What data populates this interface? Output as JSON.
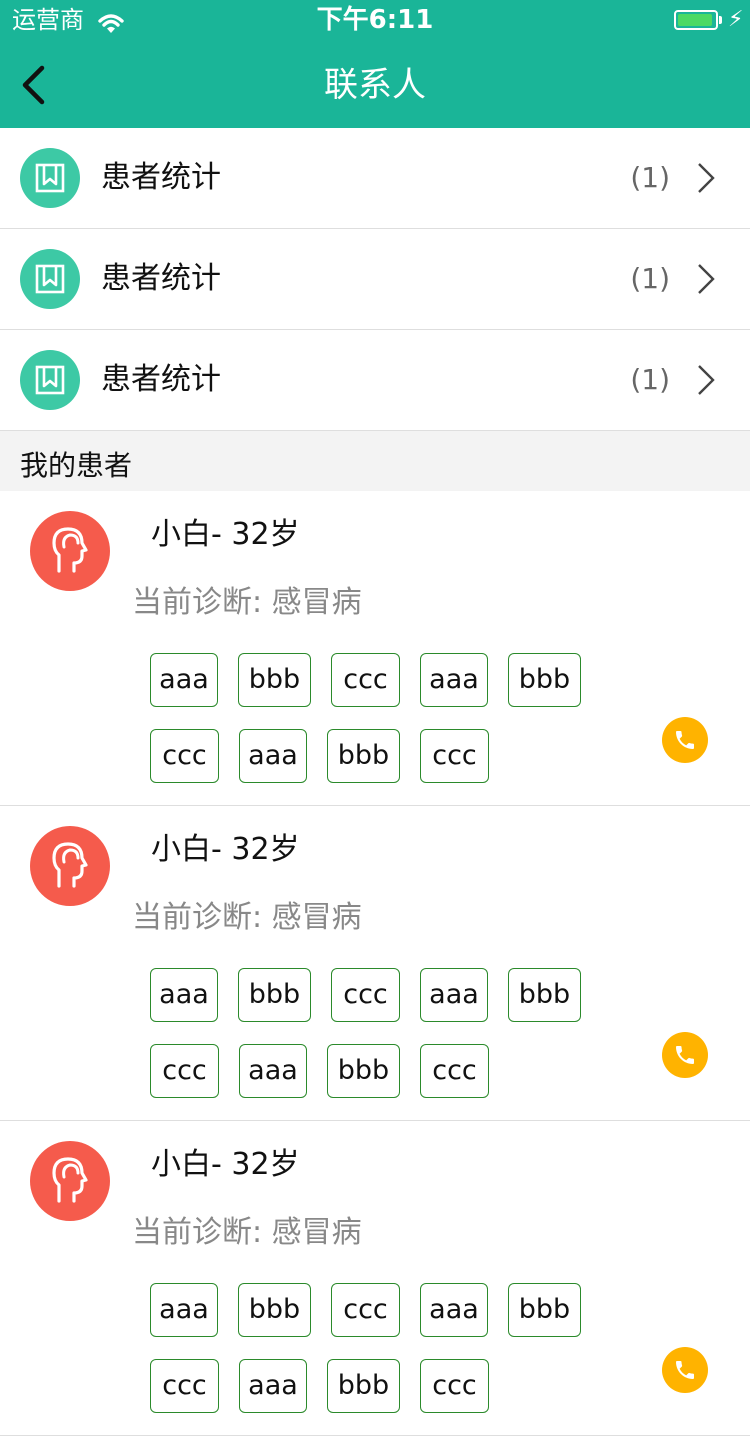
{
  "status_bar": {
    "carrier": "运营商",
    "time": "下午6:11",
    "battery_level": 0.95
  },
  "nav": {
    "title": "联系人"
  },
  "stats": [
    {
      "label": "患者统计",
      "count": "(1)"
    },
    {
      "label": "患者统计",
      "count": "(1)"
    },
    {
      "label": "患者统计",
      "count": "(1)"
    }
  ],
  "section": {
    "title": "我的患者"
  },
  "patients": [
    {
      "name": "小白- 32岁",
      "diagnosis": "当前诊断: 感冒病",
      "tags": [
        "aaa",
        "bbb",
        "ccc",
        "aaa",
        "bbb",
        "ccc",
        "aaa",
        "bbb",
        "ccc"
      ]
    },
    {
      "name": "小白- 32岁",
      "diagnosis": "当前诊断: 感冒病",
      "tags": [
        "aaa",
        "bbb",
        "ccc",
        "aaa",
        "bbb",
        "ccc",
        "aaa",
        "bbb",
        "ccc"
      ]
    },
    {
      "name": "小白- 32岁",
      "diagnosis": "当前诊断: 感冒病",
      "tags": [
        "aaa",
        "bbb",
        "ccc",
        "aaa",
        "bbb",
        "ccc",
        "aaa",
        "bbb",
        "ccc"
      ]
    }
  ],
  "colors": {
    "header": "#1ab598",
    "stat_icon": "#3dc9a5",
    "avatar": "#f55b4c",
    "phone": "#ffb300",
    "tag_border": "#2b8a2b"
  },
  "icons": {
    "stat": "bookmark-icon",
    "avatar": "person-profile-icon",
    "call": "phone-icon",
    "back": "chevron-left-icon",
    "row": "chevron-right-icon"
  }
}
